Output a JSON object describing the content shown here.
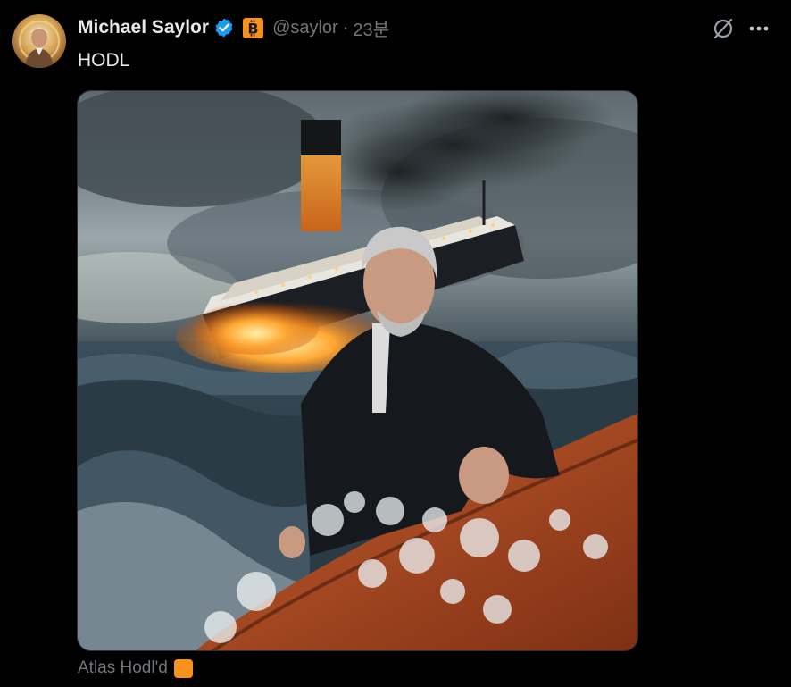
{
  "post": {
    "author": {
      "display_name": "Michael Saylor",
      "handle": "@saylor",
      "verified": true,
      "badge_icon": "bitcoin-badge-icon"
    },
    "separator": "·",
    "time": "23분",
    "text": "HODL",
    "media": {
      "image_icon": "sinking-ship-lifeboat-image"
    },
    "caption": "Atlas Hodl'd",
    "caption_emoji_icon": "orange-square-emoji"
  },
  "colors": {
    "background": "#000000",
    "text_primary": "#e7e9ea",
    "text_secondary": "#71767b",
    "verified_blue": "#1d9bf0",
    "bitcoin_orange": "#f7931a"
  }
}
